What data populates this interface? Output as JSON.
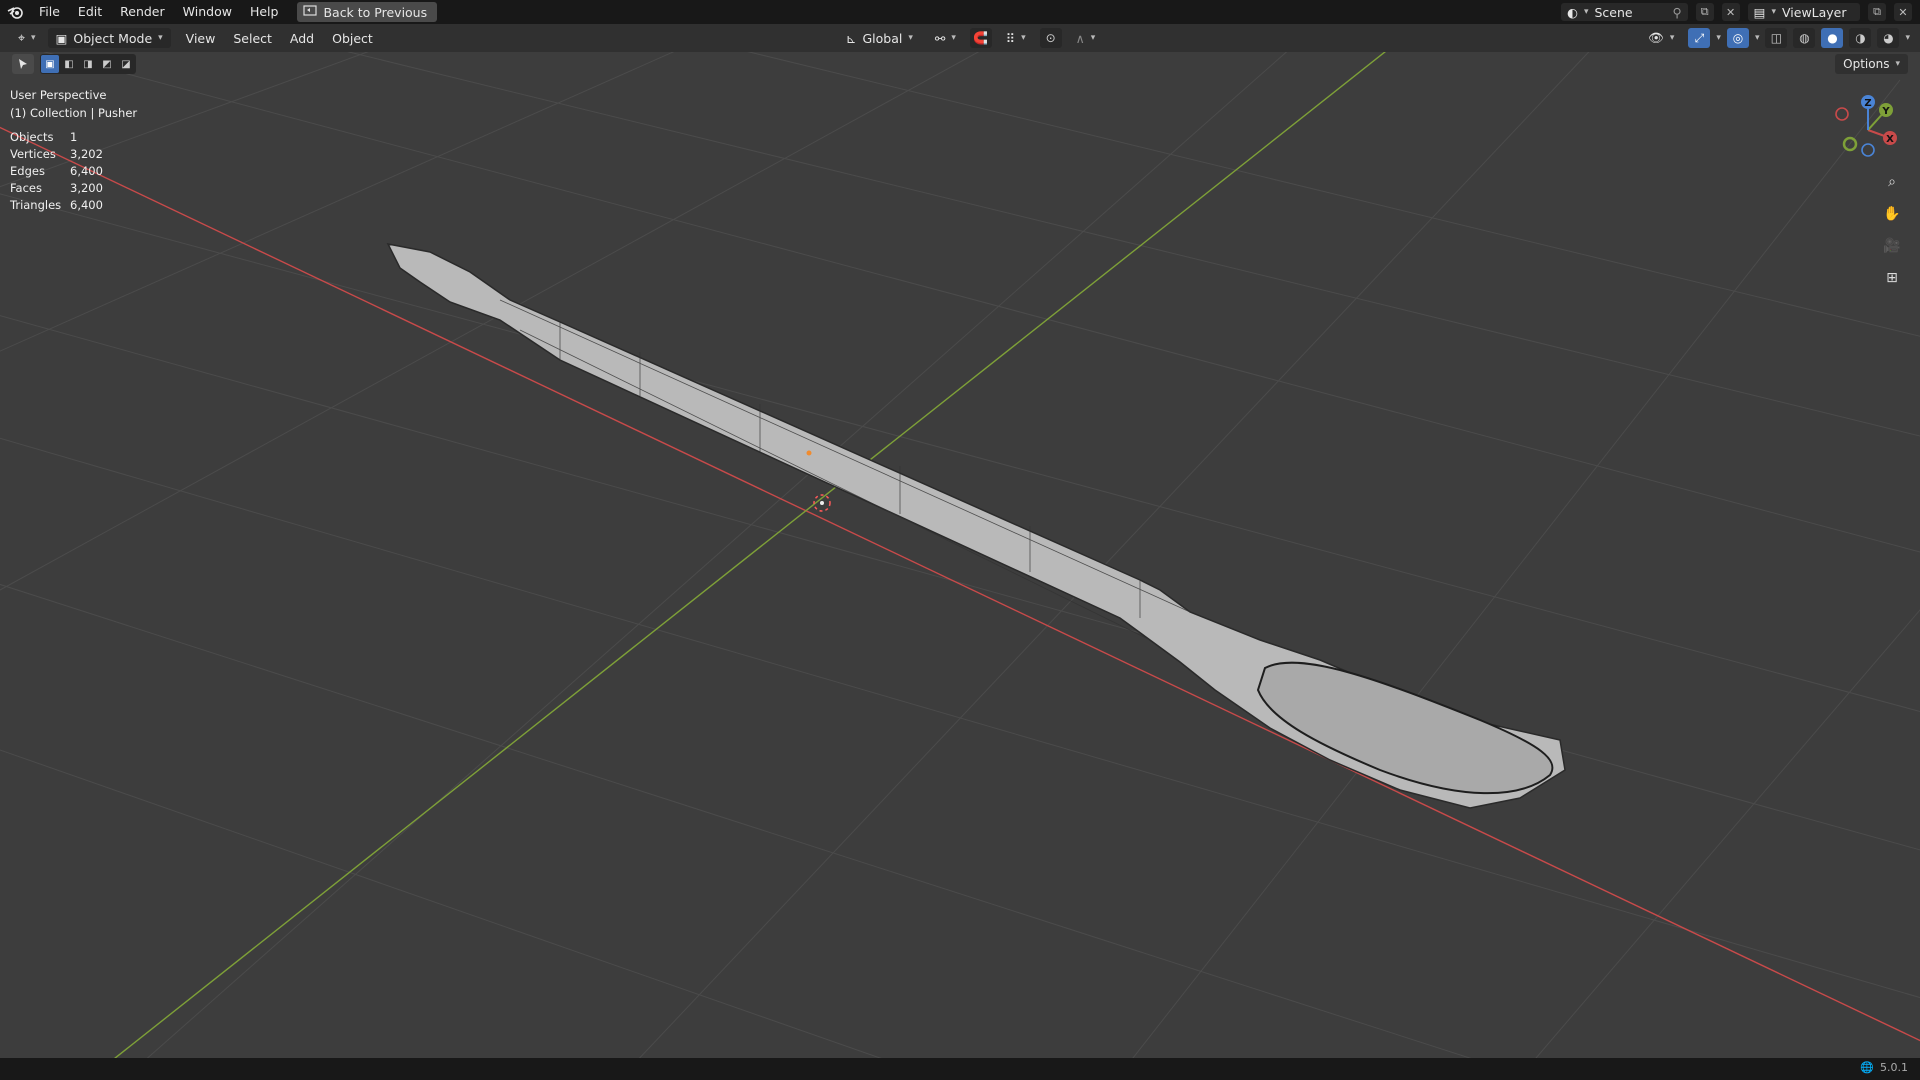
{
  "topbar": {
    "menus": [
      "File",
      "Edit",
      "Render",
      "Window",
      "Help"
    ],
    "back_label": "Back to Previous",
    "scene": "Scene",
    "view_layer": "ViewLayer"
  },
  "header": {
    "mode": "Object Mode",
    "menus": [
      "View",
      "Select",
      "Add",
      "Object"
    ],
    "transform_orientation": "Global",
    "options_label": "Options"
  },
  "viewport": {
    "perspective": "User Perspective",
    "collection": "(1) Collection | Pusher",
    "stats": [
      {
        "label": "Objects",
        "value": "1"
      },
      {
        "label": "Vertices",
        "value": "3,202"
      },
      {
        "label": "Edges",
        "value": "6,400"
      },
      {
        "label": "Faces",
        "value": "3,200"
      },
      {
        "label": "Triangles",
        "value": "6,400"
      }
    ],
    "axis_labels": {
      "x": "X",
      "y": "Y",
      "z": "Z"
    }
  },
  "status": {
    "version": "5.0.1"
  },
  "colors": {
    "x_axis": "#c84a4a",
    "y_axis": "#7ea038",
    "z_axis": "#4a84d6",
    "accent": "#3f6fb5"
  }
}
